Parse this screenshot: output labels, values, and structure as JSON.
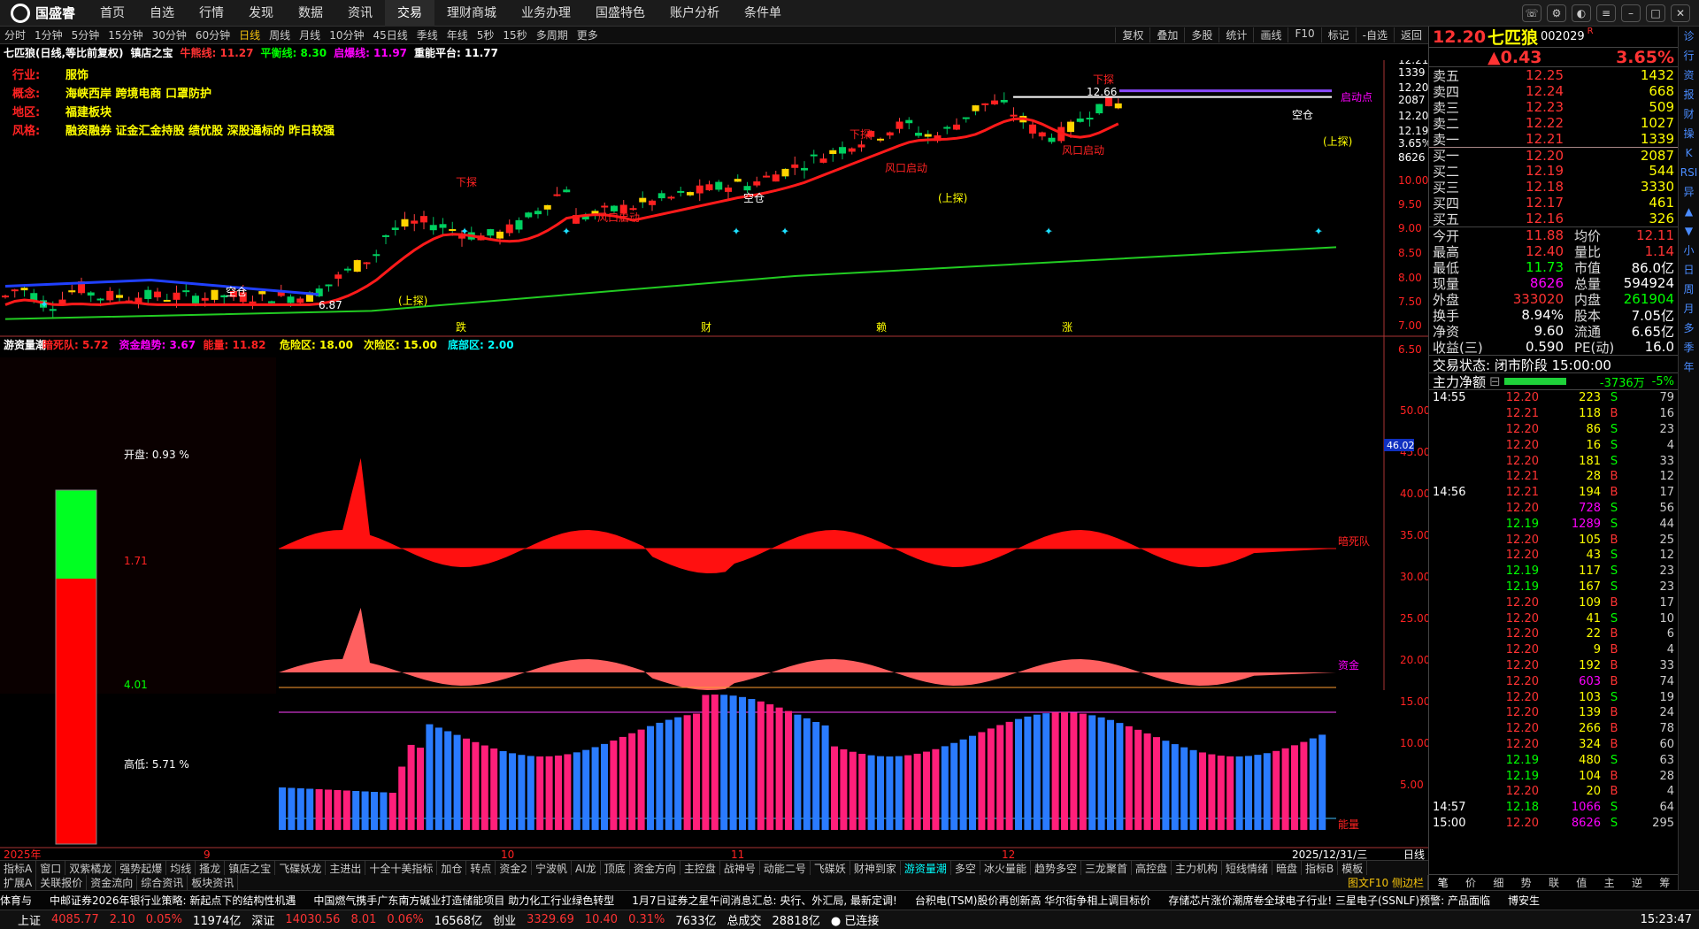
{
  "app": {
    "logo": "国盛睿"
  },
  "nav": [
    "首页",
    "自选",
    "行情",
    "发现",
    "数据",
    "资讯",
    "交易",
    "理财商城",
    "业务办理",
    "国盛特色",
    "账户分析",
    "条件单"
  ],
  "periods": [
    "分时",
    "1分钟",
    "5分钟",
    "15分钟",
    "30分钟",
    "60分钟",
    "日线",
    "周线",
    "月线",
    "10分钟",
    "45日线",
    "季线",
    "年线",
    "5秒",
    "15秒",
    "多周期",
    "更多"
  ],
  "period_active": "日线",
  "toolbar_right": [
    "复权",
    "叠加",
    "多股",
    "统计",
    "画线",
    "F10",
    "标记",
    "-自选",
    "返回"
  ],
  "chart_title": {
    "name": "七匹狼(日线,等比前复权)",
    "indicator": "镇店之宝",
    "niu": "牛熊线: 11.27",
    "ping": "平衡线: 8.30",
    "qi": "启爆线: 11.97",
    "zhong": "重能平台: 11.77"
  },
  "stock_info": [
    {
      "k": "行业:",
      "v": "服饰"
    },
    {
      "k": "概念:",
      "v": "海峡西岸 跨境电商 口罩防护"
    },
    {
      "k": "地区:",
      "v": "福建板块"
    },
    {
      "k": "风格:",
      "v": "融资融券 证金汇金持股 绩优股 深股通标的 昨日较强"
    }
  ],
  "price_axis": [
    "12.21",
    "1339",
    "12.20",
    "2087",
    "12.20",
    "12.19",
    "3.65%",
    "8626",
    "10.00",
    "9.50",
    "9.00",
    "8.50",
    "8.00",
    "7.50",
    "7.00",
    "6.50"
  ],
  "annotations": {
    "high": "12.66",
    "low": "6.87",
    "xiatan": "下探",
    "shangtan": "(上探)",
    "kongcang": "空仓",
    "fengkou": "风口启动",
    "qidong": "启动点"
  },
  "month_markers": [
    "跌",
    "财",
    "赖",
    "涨"
  ],
  "lower_title": {
    "name": "游资量潮",
    "a": "暗死队: 5.72",
    "b": "资金趋势: 3.67",
    "c": "能量: 11.82",
    "d": "危险区: 18.00",
    "e": "次险区: 15.00",
    "f": "底部区: 2.00"
  },
  "gauge": {
    "open": "开盘: 0.93 %",
    "mid1": "1.71",
    "mid2": "4.01",
    "hl": "高低: 5.71 %"
  },
  "lower_axis": [
    "50.00",
    "45.00",
    "40.00",
    "35.00",
    "30.00",
    "25.00",
    "20.00",
    "15.00",
    "10.00",
    "5.00"
  ],
  "lower_badge": "46.02",
  "lower_labels": {
    "l1": "暗死队",
    "l2": "资金",
    "l3": "能量"
  },
  "x_axis": [
    "2025年",
    "9",
    "10",
    "11",
    "12",
    "2025/12/31/三"
  ],
  "quote": {
    "price": "12.20",
    "name": "七匹狼",
    "code": "002029",
    "flag": "R",
    "chg": "0.43",
    "pct": "3.65%"
  },
  "orderbook": [
    {
      "l": "卖五",
      "p": "12.25",
      "v": "1432"
    },
    {
      "l": "卖四",
      "p": "12.24",
      "v": "668"
    },
    {
      "l": "卖三",
      "p": "12.23",
      "v": "509"
    },
    {
      "l": "卖二",
      "p": "12.22",
      "v": "1027"
    },
    {
      "l": "卖一",
      "p": "12.21",
      "v": "1339"
    },
    {
      "l": "买一",
      "p": "12.20",
      "v": "2087"
    },
    {
      "l": "买二",
      "p": "12.19",
      "v": "544"
    },
    {
      "l": "买三",
      "p": "12.18",
      "v": "3330"
    },
    {
      "l": "买四",
      "p": "12.17",
      "v": "461"
    },
    {
      "l": "买五",
      "p": "12.16",
      "v": "326"
    }
  ],
  "stats": [
    {
      "a": "今开",
      "b": "11.88",
      "c": "均价",
      "d": "12.11"
    },
    {
      "a": "最高",
      "b": "12.40",
      "c": "量比",
      "d": "1.14"
    },
    {
      "a": "最低",
      "b": "11.73",
      "c": "市值",
      "d": "86.0亿"
    },
    {
      "a": "现量",
      "b": "8626",
      "c": "总量",
      "d": "594924"
    },
    {
      "a": "外盘",
      "b": "333020",
      "c": "内盘",
      "d": "261904"
    },
    {
      "a": "换手",
      "b": "8.94%",
      "c": "股本",
      "d": "7.05亿"
    },
    {
      "a": "净资",
      "b": "9.60",
      "c": "流通",
      "d": "6.65亿"
    },
    {
      "a": "收益(三)",
      "b": "0.590",
      "c": "PE(动)",
      "d": "16.0"
    }
  ],
  "trade_state": "交易状态: 闭市阶段 15:00:00",
  "main_flow": {
    "label": "主力净额",
    "value": "-3736万",
    "pct": "-5%"
  },
  "ticks": [
    {
      "t": "14:55",
      "p": "12.20",
      "v": "223",
      "s": "S",
      "n": "79"
    },
    {
      "t": "",
      "p": "12.21",
      "v": "118",
      "s": "B",
      "n": "16"
    },
    {
      "t": "",
      "p": "12.20",
      "v": "86",
      "s": "S",
      "n": "23"
    },
    {
      "t": "",
      "p": "12.20",
      "v": "16",
      "s": "S",
      "n": "4"
    },
    {
      "t": "",
      "p": "12.20",
      "v": "181",
      "s": "S",
      "n": "33"
    },
    {
      "t": "",
      "p": "12.21",
      "v": "28",
      "s": "B",
      "n": "12"
    },
    {
      "t": "14:56",
      "p": "12.21",
      "v": "194",
      "s": "B",
      "n": "17"
    },
    {
      "t": "",
      "p": "12.20",
      "v": "728",
      "s": "S",
      "n": "56"
    },
    {
      "t": "",
      "p": "12.19",
      "v": "1289",
      "s": "S",
      "n": "44"
    },
    {
      "t": "",
      "p": "12.20",
      "v": "105",
      "s": "B",
      "n": "25"
    },
    {
      "t": "",
      "p": "12.20",
      "v": "43",
      "s": "S",
      "n": "12"
    },
    {
      "t": "",
      "p": "12.19",
      "v": "117",
      "s": "S",
      "n": "23"
    },
    {
      "t": "",
      "p": "12.19",
      "v": "167",
      "s": "S",
      "n": "23"
    },
    {
      "t": "",
      "p": "12.20",
      "v": "109",
      "s": "B",
      "n": "17"
    },
    {
      "t": "",
      "p": "12.20",
      "v": "41",
      "s": "S",
      "n": "10"
    },
    {
      "t": "",
      "p": "12.20",
      "v": "22",
      "s": "B",
      "n": "6"
    },
    {
      "t": "",
      "p": "12.20",
      "v": "9",
      "s": "B",
      "n": "4"
    },
    {
      "t": "",
      "p": "12.20",
      "v": "192",
      "s": "B",
      "n": "33"
    },
    {
      "t": "",
      "p": "12.20",
      "v": "603",
      "s": "B",
      "n": "74"
    },
    {
      "t": "",
      "p": "12.20",
      "v": "103",
      "s": "S",
      "n": "19"
    },
    {
      "t": "",
      "p": "12.20",
      "v": "139",
      "s": "B",
      "n": "24"
    },
    {
      "t": "",
      "p": "12.20",
      "v": "266",
      "s": "B",
      "n": "78"
    },
    {
      "t": "",
      "p": "12.20",
      "v": "324",
      "s": "B",
      "n": "60"
    },
    {
      "t": "",
      "p": "12.19",
      "v": "480",
      "s": "S",
      "n": "63"
    },
    {
      "t": "",
      "p": "12.19",
      "v": "104",
      "s": "B",
      "n": "28"
    },
    {
      "t": "",
      "p": "12.20",
      "v": "20",
      "s": "B",
      "n": "4"
    },
    {
      "t": "14:57",
      "p": "12.18",
      "v": "1066",
      "s": "S",
      "n": "64"
    },
    {
      "t": "15:00",
      "p": "12.20",
      "v": "8626",
      "s": "S",
      "n": "295"
    }
  ],
  "rtabs": [
    "笔",
    "价",
    "细",
    "势",
    "联",
    "值",
    "主",
    "逆",
    "筹"
  ],
  "sidebar": [
    "诊",
    "行",
    "资",
    "报",
    "财",
    "操",
    "K",
    "RSI",
    "异",
    "▲",
    "▼",
    "小",
    "日",
    "周",
    "月",
    "多",
    "季",
    "年"
  ],
  "bottom_tabs": [
    "指标A",
    "窗口",
    "双紫橘龙",
    "强势起爆",
    "均线",
    "搔龙",
    "镇店之宝",
    "飞碟妖龙",
    "主进出",
    "十全十美指标",
    "加仓",
    "转点",
    "资金2",
    "宁波帆",
    "AI龙",
    "顶底",
    "资金方向",
    "主控盘",
    "战神号",
    "动能二号",
    "飞碟妖",
    "财神到家",
    "游资量潮",
    "多空",
    "冰火量能",
    "趋势多空",
    "三龙聚首",
    "高控盘",
    "主力机构",
    "短线情绪",
    "暗盘",
    "指标B",
    "模板"
  ],
  "bottom_active": "游资量潮",
  "tabs2": [
    "扩展A",
    "关联报价",
    "资金流向",
    "综合资讯",
    "板块资讯"
  ],
  "tabs2_right": "图文F10 侧边栏",
  "news": [
    "体育与",
    "中邮证券2026年银行业策略: 新起点下的结构性机遇",
    "中国燃气携手广东南方碱业打造储能项目 助力化工行业绿色转型",
    "1月7日证券之星午间消息汇总: 央行、外汇局, 最新定调!",
    "台积电(TSM)股价再创新高 华尔街争相上调目标价",
    "存储芯片涨价潮席卷全球电子行业! 三星电子(SSNLF)预警: 产品面临",
    "博安生"
  ],
  "status": {
    "sh": "上证",
    "sh_v": "4085.77",
    "sh_c": "2.10",
    "sh_p": "0.05%",
    "sh_a": "11974亿",
    "sz": "深证",
    "sz_v": "14030.56",
    "sz_c": "8.01",
    "sz_p": "0.06%",
    "sz_a": "16568亿",
    "cy": "创业",
    "cy_v": "3329.69",
    "cy_c": "10.40",
    "cy_p": "0.31%",
    "cy_a": "7633亿",
    "tot": "总成交",
    "tot_v": "28818亿",
    "conn": "已连接",
    "time": "15:23:47"
  },
  "colors": {
    "up": "#ff2020",
    "down": "#00d060",
    "yellow": "#ffff00",
    "magenta": "#ff00ff",
    "cyan": "#00ffff"
  }
}
